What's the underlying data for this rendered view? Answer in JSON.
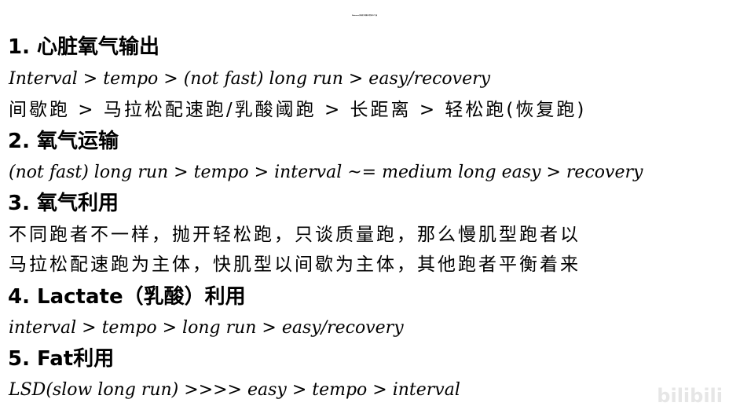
{
  "title": "Endurance(有氧能力)的提高主要来自5个方面",
  "sections": [
    {
      "heading": "1. 心脏氧气输出",
      "lines": [
        "Interval > tempo > (not fast) long run > easy/recovery",
        "间歇跑 > 马拉松配速跑/乳酸阈跑 > 长距离 > 轻松跑(恢复跑)"
      ]
    },
    {
      "heading": "2. 氧气运输",
      "lines": [
        "(not fast) long run > tempo > interval ~= medium long easy > recovery"
      ]
    },
    {
      "heading": "3. 氧气利用",
      "lines": [
        "不同跑者不一样，抛开轻松跑，只谈质量跑，那么慢肌型跑者以",
        "马拉松配速跑为主体，快肌型以间歇为主体，其他跑者平衡着来"
      ]
    },
    {
      "heading": "4. Lactate（乳酸）利用",
      "lines": [
        "interval > tempo > long run > easy/recovery"
      ]
    },
    {
      "heading": "5. Fat利用",
      "lines": [
        "LSD(slow long run) >>>> easy > tempo > interval"
      ]
    }
  ],
  "watermark": "bilibili"
}
